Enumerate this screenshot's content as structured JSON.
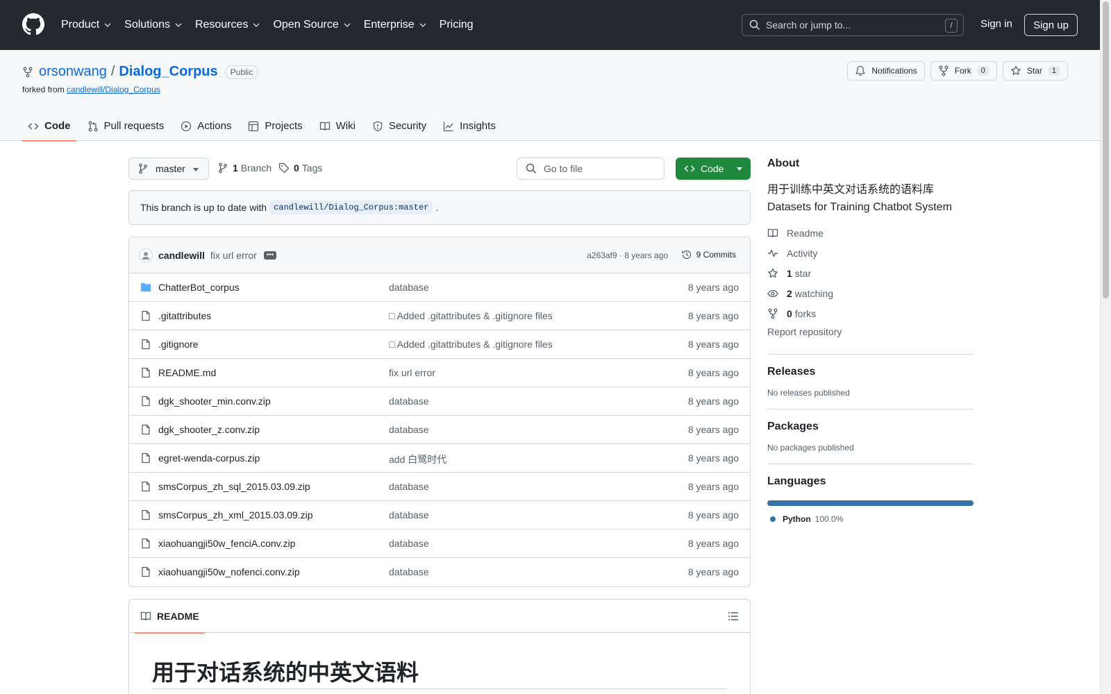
{
  "header": {
    "nav": [
      "Product",
      "Solutions",
      "Resources",
      "Open Source",
      "Enterprise",
      "Pricing"
    ],
    "search_placeholder": "Search or jump to...",
    "search_shortcut": "/",
    "sign_in": "Sign in",
    "sign_up": "Sign up"
  },
  "repo": {
    "owner": "orsonwang",
    "separator": "/",
    "name": "Dialog_Corpus",
    "visibility": "Public",
    "forked_prefix": "forked from",
    "forked_from": "candlewill/Dialog_Corpus",
    "actions": {
      "notifications": "Notifications",
      "fork": "Fork",
      "fork_count": "0",
      "star": "Star",
      "star_count": "1"
    },
    "tabs": [
      "Code",
      "Pull requests",
      "Actions",
      "Projects",
      "Wiki",
      "Security",
      "Insights"
    ]
  },
  "toolbar": {
    "branch": "master",
    "branch_count": "1",
    "branch_label": "Branch",
    "tag_count": "0",
    "tag_label": "Tags",
    "go_to_file": "Go to file",
    "code_button": "Code"
  },
  "uptodate": {
    "prefix": "This branch is up to date with",
    "ref": "candlewill/Dialog_Corpus:master",
    "suffix": "."
  },
  "commit": {
    "author": "candlewill",
    "message": "fix url error",
    "dots": "•••",
    "meta": "a263af9 · 8 years ago",
    "commits": "9 Commits"
  },
  "files": [
    {
      "type": "dir",
      "name": "ChatterBot_corpus",
      "message": "database",
      "age": "8 years ago"
    },
    {
      "type": "file",
      "name": ".gitattributes",
      "message": "□ Added .gitattributes & .gitignore files",
      "age": "8 years ago"
    },
    {
      "type": "file",
      "name": ".gitignore",
      "message": "□ Added .gitattributes & .gitignore files",
      "age": "8 years ago"
    },
    {
      "type": "file",
      "name": "README.md",
      "message": "fix url error",
      "age": "8 years ago"
    },
    {
      "type": "file",
      "name": "dgk_shooter_min.conv.zip",
      "message": "database",
      "age": "8 years ago"
    },
    {
      "type": "file",
      "name": "dgk_shooter_z.conv.zip",
      "message": "database",
      "age": "8 years ago"
    },
    {
      "type": "file",
      "name": "egret-wenda-corpus.zip",
      "message": "add 白鹭时代",
      "age": "8 years ago"
    },
    {
      "type": "file",
      "name": "smsCorpus_zh_sql_2015.03.09.zip",
      "message": "database",
      "age": "8 years ago"
    },
    {
      "type": "file",
      "name": "smsCorpus_zh_xml_2015.03.09.zip",
      "message": "database",
      "age": "8 years ago"
    },
    {
      "type": "file",
      "name": "xiaohuangji50w_fenciA.conv.zip",
      "message": "database",
      "age": "8 years ago"
    },
    {
      "type": "file",
      "name": "xiaohuangji50w_nofenci.conv.zip",
      "message": "database",
      "age": "8 years ago"
    }
  ],
  "readme": {
    "tab": "README",
    "heading": "用于对话系统的中英文语料"
  },
  "sidebar": {
    "about_title": "About",
    "description_line1": "用于训练中英文对话系统的语料库",
    "description_line2": "Datasets for Training Chatbot System",
    "readme": "Readme",
    "activity": "Activity",
    "stars_count": "1",
    "stars_label": "star",
    "watching_count": "2",
    "watching_label": "watching",
    "forks_count": "0",
    "forks_label": "forks",
    "report": "Report repository",
    "releases_title": "Releases",
    "releases_empty": "No releases published",
    "packages_title": "Packages",
    "packages_empty": "No packages published",
    "languages_title": "Languages",
    "language_name": "Python",
    "language_pct": "100.0%",
    "language_color": "#3572a5"
  },
  "colors": {
    "header_bg": "#24292f",
    "link": "#0969da",
    "primary_button": "#1f883d",
    "tab_underline": "#fd8c73"
  }
}
